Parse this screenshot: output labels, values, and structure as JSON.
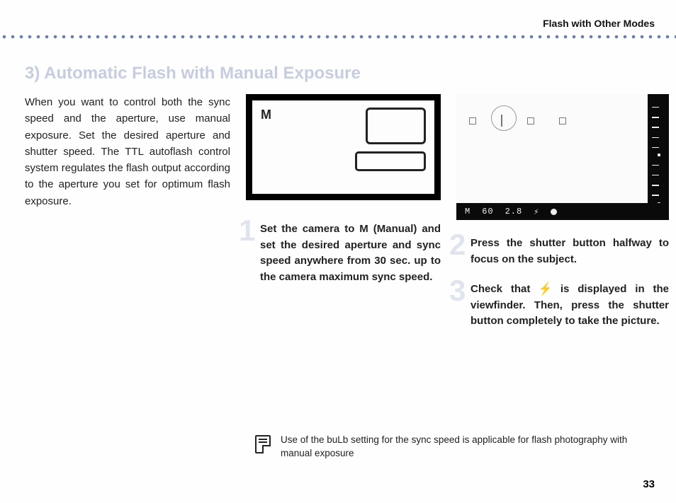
{
  "header": {
    "section_label": "Flash with Other Modes"
  },
  "title": "3) Automatic Flash with Manual Exposure",
  "intro": "When you want to control both the sync speed and the aperture, use manual exposure. Set the desired aperture and shutter speed. The TTL autoflash control system regulates the flash output according to the aperture you set for optimum flash exposure.",
  "lcd": {
    "mode_indicator": "M"
  },
  "viewfinder": {
    "mode": "M",
    "shutter": "60",
    "aperture": "2.8",
    "flash_ready": "⚡",
    "focus_confirm": "●"
  },
  "steps": [
    {
      "num": "1",
      "text": "Set the camera to M (Manual) and set the desired aperture and sync speed anywhere from 30 sec. up to the camera maximum sync speed."
    },
    {
      "num": "2",
      "text": "Press the shutter button halfway to focus on the subject."
    },
    {
      "num": "3",
      "text_pre": "Check that ",
      "flash_glyph": "⚡",
      "text_post": " is displayed in the viewfinder. Then, press the shutter button completely to take the picture."
    }
  ],
  "note": "Use of the buLb setting for the sync speed is applicable for flash photography with manual exposure",
  "page_number": "33"
}
